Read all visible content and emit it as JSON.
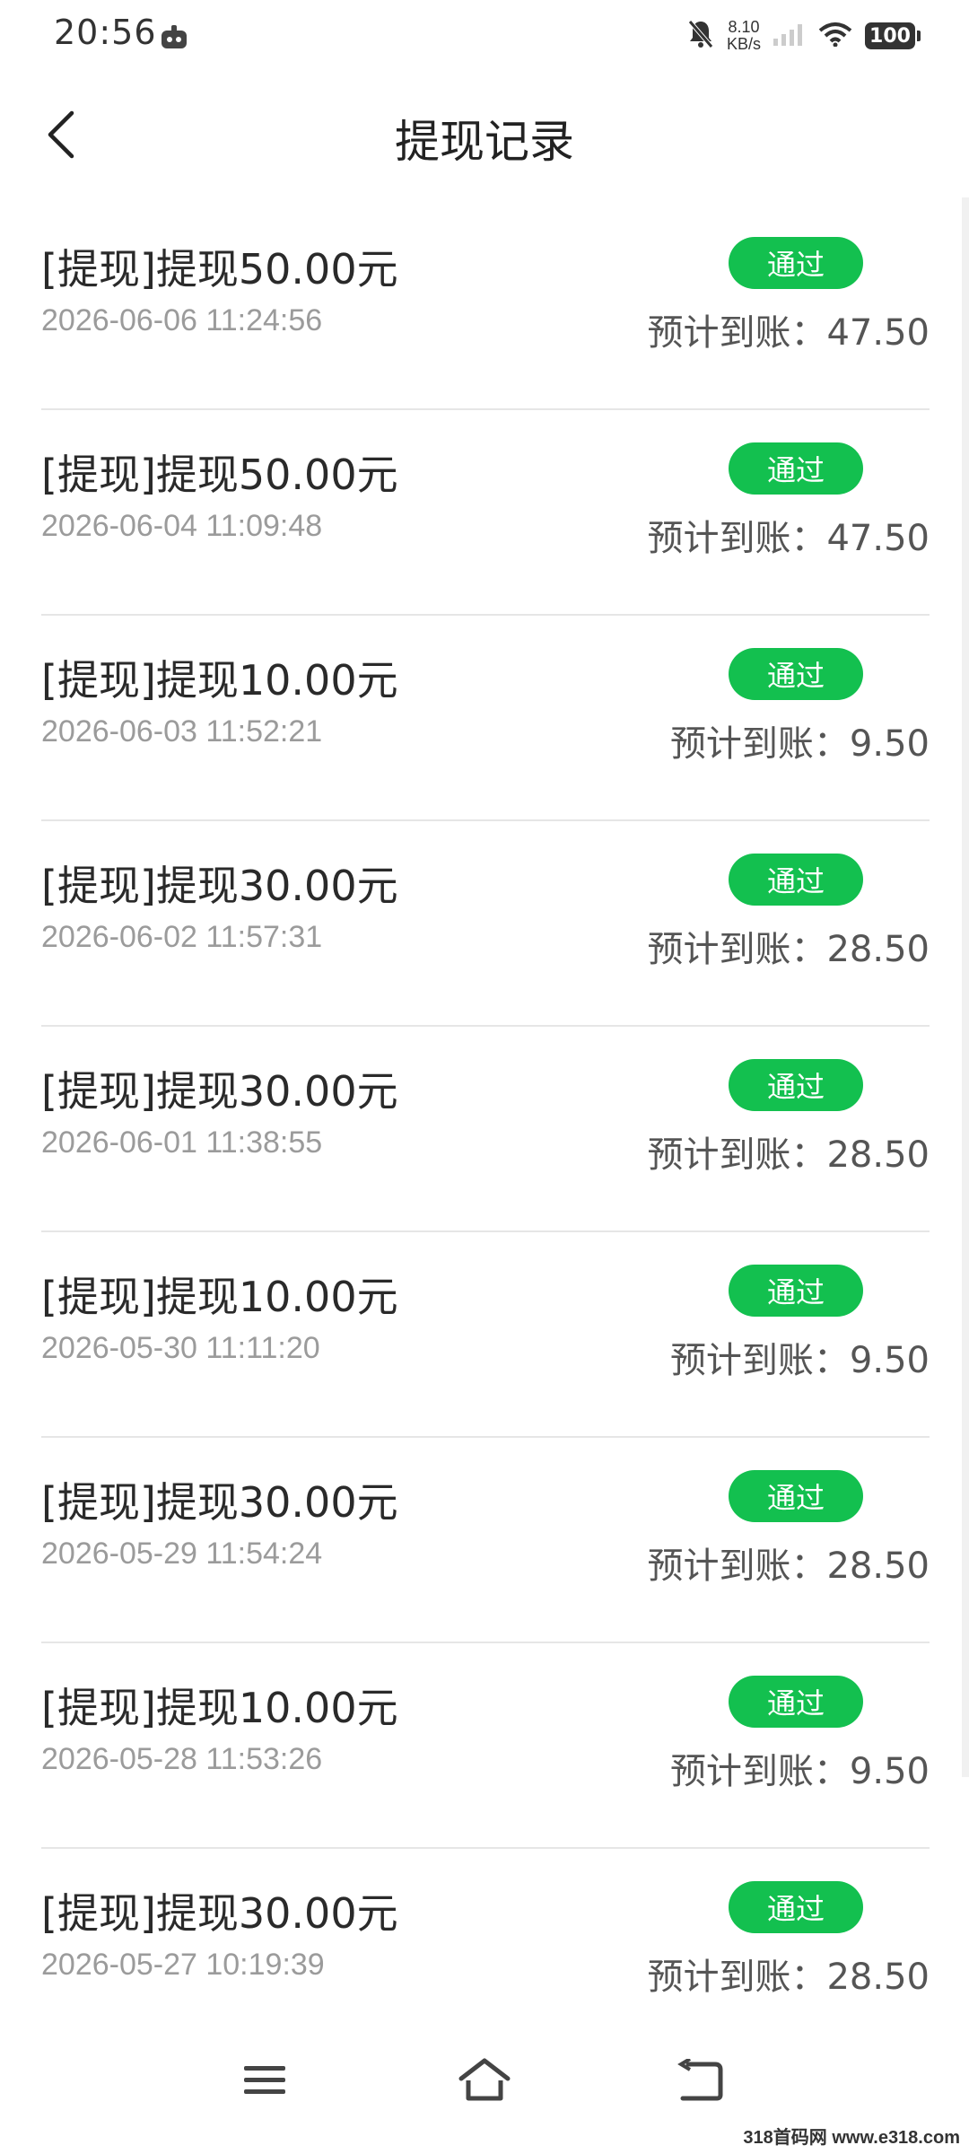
{
  "status_bar": {
    "time": "20:56",
    "net_speed_value": "8.10",
    "net_speed_unit": "KB/s",
    "battery": "100"
  },
  "header": {
    "title": "提现记录"
  },
  "records": [
    {
      "title": "[提现]提现50.00元",
      "time": "2026-06-06 11:24:56",
      "status": "通过",
      "amount": "预计到账：47.50"
    },
    {
      "title": "[提现]提现50.00元",
      "time": "2026-06-04 11:09:48",
      "status": "通过",
      "amount": "预计到账：47.50"
    },
    {
      "title": "[提现]提现10.00元",
      "time": "2026-06-03 11:52:21",
      "status": "通过",
      "amount": "预计到账：9.50"
    },
    {
      "title": "[提现]提现30.00元",
      "time": "2026-06-02 11:57:31",
      "status": "通过",
      "amount": "预计到账：28.50"
    },
    {
      "title": "[提现]提现30.00元",
      "time": "2026-06-01 11:38:55",
      "status": "通过",
      "amount": "预计到账：28.50"
    },
    {
      "title": "[提现]提现10.00元",
      "time": "2026-05-30 11:11:20",
      "status": "通过",
      "amount": "预计到账：9.50"
    },
    {
      "title": "[提现]提现30.00元",
      "time": "2026-05-29 11:54:24",
      "status": "通过",
      "amount": "预计到账：28.50"
    },
    {
      "title": "[提现]提现10.00元",
      "time": "2026-05-28 11:53:26",
      "status": "通过",
      "amount": "预计到账：9.50"
    },
    {
      "title": "[提现]提现30.00元",
      "time": "2026-05-27 10:19:39",
      "status": "通过",
      "amount": "预计到账：28.50"
    }
  ],
  "icons": {
    "back": "chevron-left-icon",
    "menu": "menu-icon",
    "home": "home-icon",
    "return": "back-arrow-icon"
  },
  "colors": {
    "badge_green": "#13c04f"
  },
  "watermark": "318首码网 www.e318.com"
}
